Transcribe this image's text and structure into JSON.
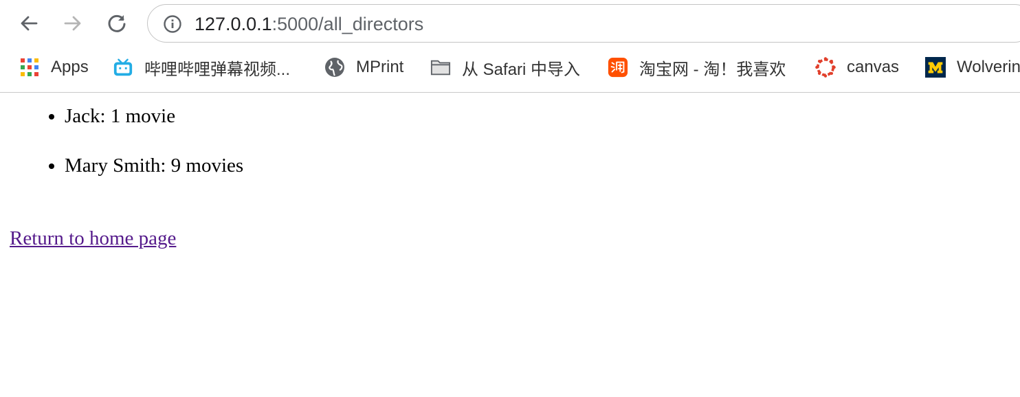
{
  "browser": {
    "url_host": "127.0.0.1",
    "url_rest": ":5000/all_directors",
    "bookmarks": [
      {
        "label": "Apps",
        "icon": "apps-grid-icon"
      },
      {
        "label": "哔哩哔哩弹幕视频...",
        "icon": "bilibili-icon"
      },
      {
        "label": "MPrint",
        "icon": "globe-icon"
      },
      {
        "label": "从 Safari 中导入",
        "icon": "folder-icon"
      },
      {
        "label": "淘宝网 - 淘！我喜欢",
        "icon": "taobao-icon"
      },
      {
        "label": "canvas",
        "icon": "canvas-icon"
      },
      {
        "label": "Wolverine",
        "icon": "michigan-icon"
      }
    ],
    "colors": {
      "link_visited": "#551a8b",
      "bilibili": "#23ade5",
      "taobao": "#ff5000",
      "canvas": "#e13f2b",
      "michigan_blue": "#00274c",
      "michigan_maize": "#ffcb05"
    }
  },
  "page": {
    "directors": [
      {
        "text": "Jack: 1 movie"
      },
      {
        "text": "Mary Smith: 9 movies"
      }
    ],
    "home_link": "Return to home page"
  }
}
